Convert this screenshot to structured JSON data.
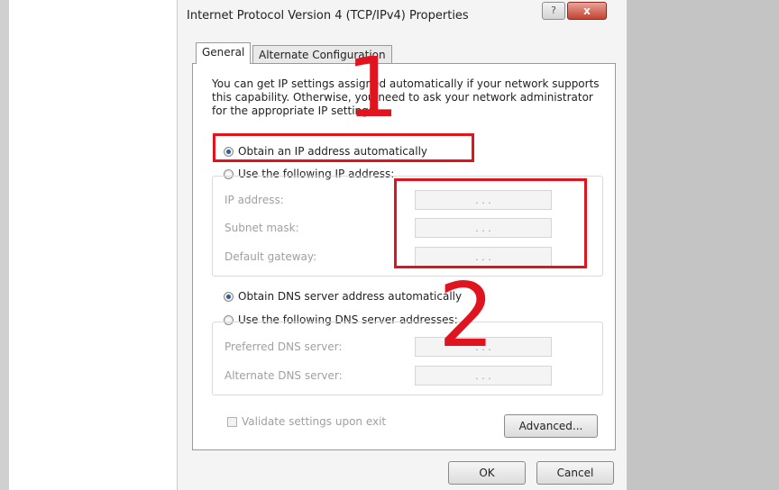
{
  "window": {
    "title": "Internet Protocol Version 4 (TCP/IPv4) Properties",
    "help_symbol": "?",
    "close_symbol": "x"
  },
  "tabs": [
    {
      "label": "General",
      "active": true
    },
    {
      "label": "Alternate Configuration",
      "active": false
    }
  ],
  "intro_text": "You can get IP settings assigned automatically if your network supports this capability. Otherwise, you need to ask your network administrator for the appropriate IP settings.",
  "ip_section": {
    "obtain_auto_label": "Obtain an IP address automatically",
    "obtain_auto_selected": true,
    "use_following_label": "Use the following IP address:",
    "fields": [
      {
        "label": "IP address:",
        "value": ". . ."
      },
      {
        "label": "Subnet mask:",
        "value": ". . ."
      },
      {
        "label": "Default gateway:",
        "value": ". . ."
      }
    ]
  },
  "dns_section": {
    "obtain_auto_label": "Obtain DNS server address automatically",
    "obtain_auto_selected": true,
    "use_following_label": "Use the following DNS server addresses:",
    "fields": [
      {
        "label": "Preferred DNS server:",
        "value": ". . ."
      },
      {
        "label": "Alternate DNS server:",
        "value": ". . ."
      }
    ]
  },
  "validate_label": "Validate settings upon exit",
  "buttons": {
    "advanced": "Advanced...",
    "ok": "OK",
    "cancel": "Cancel"
  },
  "annotations": {
    "marker_1": "1",
    "marker_2": "2",
    "color": "#e0141e"
  }
}
